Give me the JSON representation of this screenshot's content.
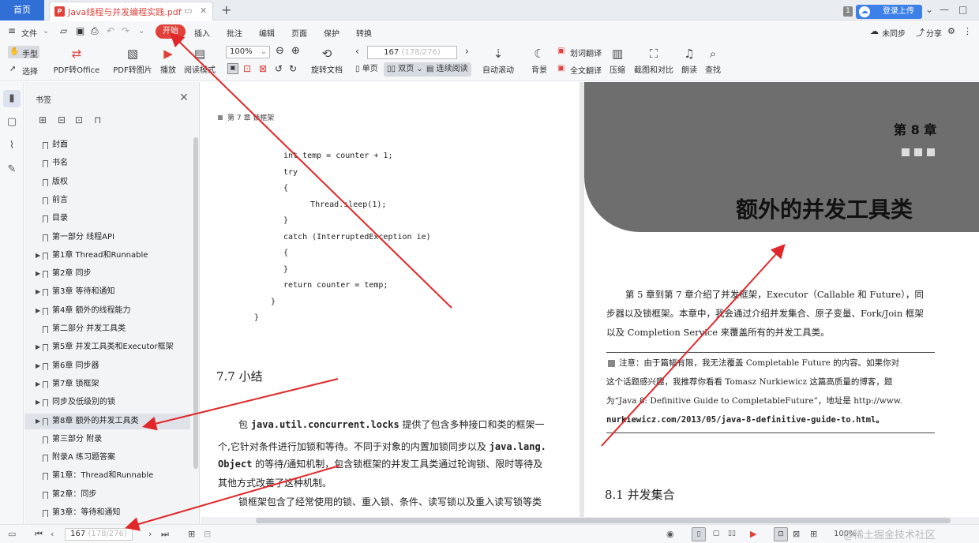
{
  "tabs": {
    "home": "首页",
    "doc_title": "Java线程与并发编程实践.pdf"
  },
  "titlebar": {
    "badge": "1",
    "upload_label": "登录上传"
  },
  "menu": {
    "file": "文件",
    "items": [
      "开始",
      "插入",
      "批注",
      "编辑",
      "页面",
      "保护",
      "转换"
    ],
    "right": [
      "未同步",
      "分享"
    ]
  },
  "toolbar": {
    "hand": "手型",
    "select": "选择",
    "pdf_office": "PDF转Office",
    "pdf_image": "PDF转图片",
    "play": "播放",
    "read_mode": "阅读模式",
    "zoom": "100%",
    "rotate": "旋转文档",
    "page_current": "167",
    "page_total": "(178/276)",
    "single": "单页",
    "double": "双页",
    "continuous": "连续阅读",
    "autoscroll": "自动滚动",
    "background": "背景",
    "word_translate": "划词翻译",
    "full_translate": "全文翻译",
    "compress": "压缩",
    "screenshot": "截图和对比",
    "read_aloud": "朗读",
    "find": "查找"
  },
  "bookmarks": {
    "header": "书签",
    "items": [
      {
        "label": "封面",
        "expand": false
      },
      {
        "label": "书名",
        "expand": false
      },
      {
        "label": "版权",
        "expand": false
      },
      {
        "label": "前言",
        "expand": false
      },
      {
        "label": "目录",
        "expand": false
      },
      {
        "label": "第一部分   线程API",
        "expand": false
      },
      {
        "label": "第1章 Thread和Runnable",
        "expand": true
      },
      {
        "label": "第2章 同步",
        "expand": true
      },
      {
        "label": "第3章 等待和通知",
        "expand": true
      },
      {
        "label": "第4章 额外的线程能力",
        "expand": true
      },
      {
        "label": "第二部分   并发工具类",
        "expand": false
      },
      {
        "label": "第5章 并发工具类和Executor框架",
        "expand": true
      },
      {
        "label": "第6章 同步器",
        "expand": true
      },
      {
        "label": "第7章 锁框架",
        "expand": true
      },
      {
        "label": "同步及低级别的锁",
        "expand": true
      },
      {
        "label": "第8章 额外的并发工具类",
        "expand": true,
        "selected": true
      },
      {
        "label": "第三部分   附录",
        "expand": false
      },
      {
        "label": "附录A   练习题答案",
        "expand": false
      },
      {
        "label": "第1章：Thread和Runnable",
        "expand": false
      },
      {
        "label": "第2章：同步",
        "expand": false
      },
      {
        "label": "第3章：等待和通知",
        "expand": false
      }
    ]
  },
  "left_page": {
    "header": "第 7 章   锁框架",
    "code": [
      "int temp = counter + 1;",
      "try",
      "{",
      "   Thread.sleep(1);",
      "}",
      "catch (InterruptedException ie)",
      "{",
      "}",
      "return counter = temp;",
      "}",
      "}"
    ],
    "section": "7.7   小结",
    "para1": [
      {
        "t": "包 ",
        "m": false
      },
      {
        "t": "java.util.concurrent.locks",
        "m": true
      },
      {
        "t": " 提供了包含多种接口和类的框架一",
        "m": false
      }
    ],
    "para2": [
      {
        "t": "个,它针对条件进行加锁和等待。不同于对象的内置加锁同步以及 ",
        "m": false
      },
      {
        "t": "java.lang.",
        "m": true
      }
    ],
    "para3": [
      {
        "t": "Object",
        "m": true
      },
      {
        "t": " 的等待/通知机制，包含锁框架的并发工具类通过轮询锁、限时等待及",
        "m": false
      }
    ],
    "para4": "其他方式改善了这种机制。",
    "para5": "锁框架包含了经常使用的锁、重入锁、条件、读写锁以及重入读写锁等类"
  },
  "right_page": {
    "chapter": "第 8 章",
    "title": "额外的并发工具类",
    "intro1": "第 5 章到第 7 章介绍了并发框架，Executor（Callable 和 Future），同",
    "intro2": "步器以及锁框架。本章中，我会通过介绍并发集合、原子变量、Fork/Join 框架",
    "intro3": "以及 Completion Service 来覆盖所有的并发工具类。",
    "note1": "注意：由于篇幅有限，我无法覆盖 Completable Future 的内容。如果你对",
    "note2": "这个话题感兴趣，我推荐你看看 Tomasz Nurkiewicz 这篇高质量的博客，题",
    "note3": "为“Java 8: Definitive Guide to CompletableFuture”，地址是 http://www.",
    "note4": "nurkiewicz.com/2013/05/java-8-definitive-guide-to.html。",
    "section": "8.1   并发集合"
  },
  "statusbar": {
    "page_current": "167",
    "page_total": "(178/276)",
    "zoom": "100%",
    "watermark": "@稀土掘金技术社区"
  },
  "colors": {
    "accent": "#2f6fd6",
    "arrow": "#e0282a",
    "pdf_red": "#e0413a"
  }
}
